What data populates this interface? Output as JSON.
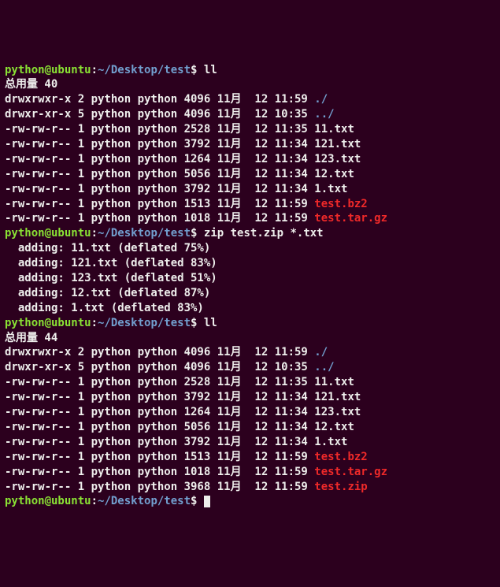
{
  "prompt": {
    "user": "python@ubuntu",
    "sep1": ":",
    "path": "~/Desktop/test",
    "sep2": "$ "
  },
  "cmd1": "ll",
  "total1": "总用量 40",
  "ls1": [
    {
      "perm": "drwxrwxr-x",
      "links": "2",
      "own": "python",
      "grp": "python",
      "size": "4096",
      "mon": "11月",
      "day": "12",
      "time": "11:59",
      "name": "./",
      "cls": "dir"
    },
    {
      "perm": "drwxr-xr-x",
      "links": "5",
      "own": "python",
      "grp": "python",
      "size": "4096",
      "mon": "11月",
      "day": "12",
      "time": "10:35",
      "name": "../",
      "cls": "dir"
    },
    {
      "perm": "-rw-rw-r--",
      "links": "1",
      "own": "python",
      "grp": "python",
      "size": "2528",
      "mon": "11月",
      "day": "12",
      "time": "11:35",
      "name": "11.txt",
      "cls": "cmd"
    },
    {
      "perm": "-rw-rw-r--",
      "links": "1",
      "own": "python",
      "grp": "python",
      "size": "3792",
      "mon": "11月",
      "day": "12",
      "time": "11:34",
      "name": "121.txt",
      "cls": "cmd"
    },
    {
      "perm": "-rw-rw-r--",
      "links": "1",
      "own": "python",
      "grp": "python",
      "size": "1264",
      "mon": "11月",
      "day": "12",
      "time": "11:34",
      "name": "123.txt",
      "cls": "cmd"
    },
    {
      "perm": "-rw-rw-r--",
      "links": "1",
      "own": "python",
      "grp": "python",
      "size": "5056",
      "mon": "11月",
      "day": "12",
      "time": "11:34",
      "name": "12.txt",
      "cls": "cmd"
    },
    {
      "perm": "-rw-rw-r--",
      "links": "1",
      "own": "python",
      "grp": "python",
      "size": "3792",
      "mon": "11月",
      "day": "12",
      "time": "11:34",
      "name": "1.txt",
      "cls": "cmd"
    },
    {
      "perm": "-rw-rw-r--",
      "links": "1",
      "own": "python",
      "grp": "python",
      "size": "1513",
      "mon": "11月",
      "day": "12",
      "time": "11:59",
      "name": "test.bz2",
      "cls": "arc"
    },
    {
      "perm": "-rw-rw-r--",
      "links": "1",
      "own": "python",
      "grp": "python",
      "size": "1018",
      "mon": "11月",
      "day": "12",
      "time": "11:59",
      "name": "test.tar.gz",
      "cls": "arc"
    }
  ],
  "cmd2": "zip test.zip *.txt",
  "zip_out": [
    "  adding: 11.txt (deflated 75%)",
    "  adding: 121.txt (deflated 83%)",
    "  adding: 123.txt (deflated 51%)",
    "  adding: 12.txt (deflated 87%)",
    "  adding: 1.txt (deflated 83%)"
  ],
  "cmd3": "ll",
  "total2": "总用量 44",
  "ls2": [
    {
      "perm": "drwxrwxr-x",
      "links": "2",
      "own": "python",
      "grp": "python",
      "size": "4096",
      "mon": "11月",
      "day": "12",
      "time": "11:59",
      "name": "./",
      "cls": "dir"
    },
    {
      "perm": "drwxr-xr-x",
      "links": "5",
      "own": "python",
      "grp": "python",
      "size": "4096",
      "mon": "11月",
      "day": "12",
      "time": "10:35",
      "name": "../",
      "cls": "dir"
    },
    {
      "perm": "-rw-rw-r--",
      "links": "1",
      "own": "python",
      "grp": "python",
      "size": "2528",
      "mon": "11月",
      "day": "12",
      "time": "11:35",
      "name": "11.txt",
      "cls": "cmd"
    },
    {
      "perm": "-rw-rw-r--",
      "links": "1",
      "own": "python",
      "grp": "python",
      "size": "3792",
      "mon": "11月",
      "day": "12",
      "time": "11:34",
      "name": "121.txt",
      "cls": "cmd"
    },
    {
      "perm": "-rw-rw-r--",
      "links": "1",
      "own": "python",
      "grp": "python",
      "size": "1264",
      "mon": "11月",
      "day": "12",
      "time": "11:34",
      "name": "123.txt",
      "cls": "cmd"
    },
    {
      "perm": "-rw-rw-r--",
      "links": "1",
      "own": "python",
      "grp": "python",
      "size": "5056",
      "mon": "11月",
      "day": "12",
      "time": "11:34",
      "name": "12.txt",
      "cls": "cmd"
    },
    {
      "perm": "-rw-rw-r--",
      "links": "1",
      "own": "python",
      "grp": "python",
      "size": "3792",
      "mon": "11月",
      "day": "12",
      "time": "11:34",
      "name": "1.txt",
      "cls": "cmd"
    },
    {
      "perm": "-rw-rw-r--",
      "links": "1",
      "own": "python",
      "grp": "python",
      "size": "1513",
      "mon": "11月",
      "day": "12",
      "time": "11:59",
      "name": "test.bz2",
      "cls": "arc"
    },
    {
      "perm": "-rw-rw-r--",
      "links": "1",
      "own": "python",
      "grp": "python",
      "size": "1018",
      "mon": "11月",
      "day": "12",
      "time": "11:59",
      "name": "test.tar.gz",
      "cls": "arc"
    },
    {
      "perm": "-rw-rw-r--",
      "links": "1",
      "own": "python",
      "grp": "python",
      "size": "3968",
      "mon": "11月",
      "day": "12",
      "time": "11:59",
      "name": "test.zip",
      "cls": "arc"
    }
  ]
}
